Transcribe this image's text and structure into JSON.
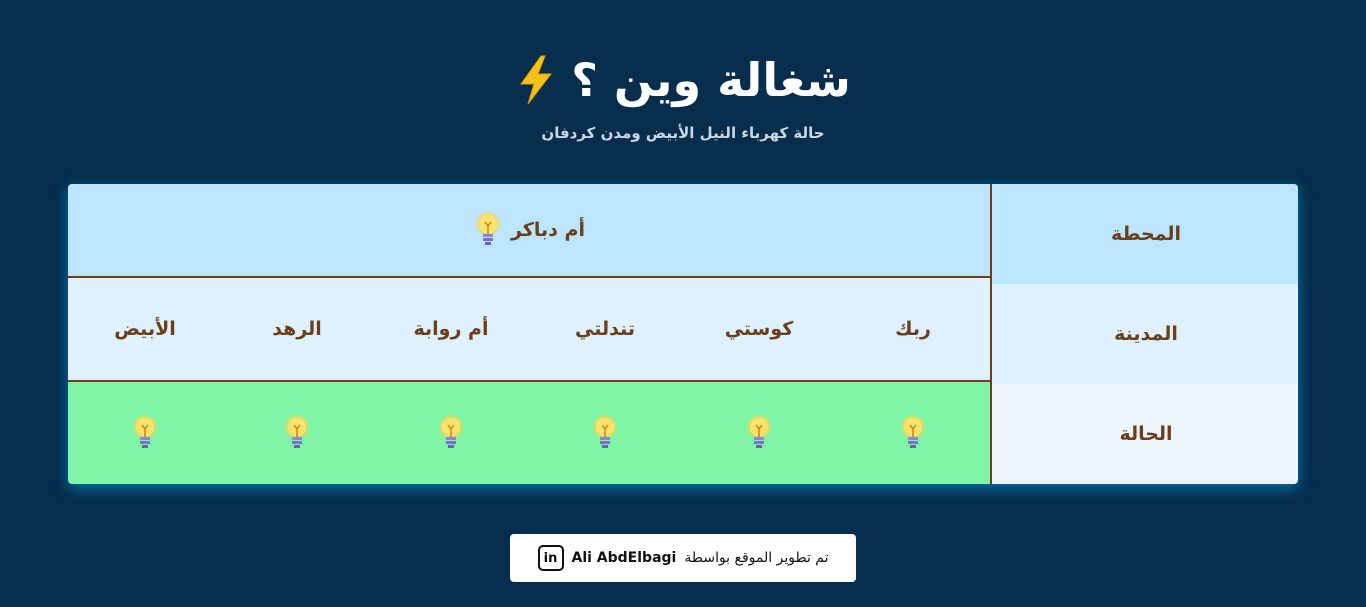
{
  "header": {
    "title": "شغالة وين ؟",
    "subtitle": "حالة كهرباء النيل الأبيض ومدن كردفان"
  },
  "table": {
    "row_labels": {
      "station": "المحطة",
      "city": "المدينة",
      "status": "الحالة"
    },
    "station": {
      "name": "أم دباكر",
      "icon": "lightbulb-icon"
    },
    "cities": [
      {
        "name": "ربك",
        "status": "on",
        "icon": "lightbulb-icon"
      },
      {
        "name": "كوستي",
        "status": "on",
        "icon": "lightbulb-icon"
      },
      {
        "name": "تندلتي",
        "status": "on",
        "icon": "lightbulb-icon"
      },
      {
        "name": "أم روابة",
        "status": "on",
        "icon": "lightbulb-icon"
      },
      {
        "name": "الرهد",
        "status": "on",
        "icon": "lightbulb-icon"
      },
      {
        "name": "الأبيض",
        "status": "on",
        "icon": "lightbulb-icon"
      }
    ],
    "colors": {
      "station_bg": "#bce6fd",
      "status_on_bg": "#7ff5a8",
      "text": "#6b3f1c"
    }
  },
  "footer": {
    "credit_text": "تم تطوير الموقع بواسطة",
    "author": "Ali AbdElbagi",
    "icon": "linkedin-icon"
  }
}
